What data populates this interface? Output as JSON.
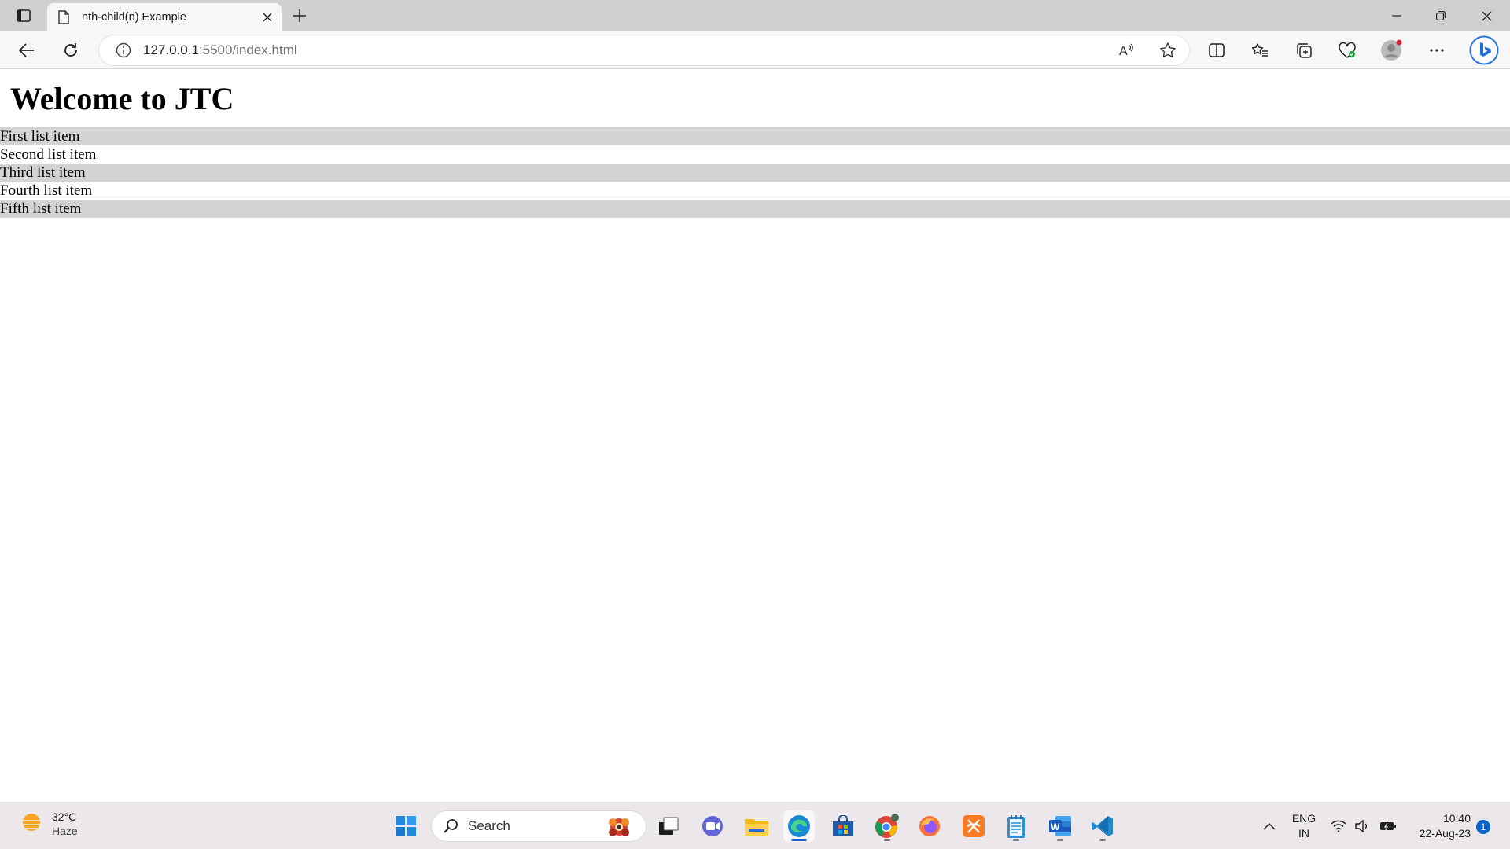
{
  "browser": {
    "tab_title": "nth-child(n) Example",
    "url_host": "127.0.0.1",
    "url_rest": ":5500/index.html"
  },
  "page": {
    "heading": "Welcome to JTC",
    "list_items": [
      "First list item",
      "Second list item",
      "Third list item",
      "Fourth list item",
      "Fifth list item"
    ],
    "stripe_color": "#d3d3d3"
  },
  "taskbar": {
    "weather_temp": "32°C",
    "weather_condition": "Haze",
    "search_label": "Search",
    "lang_primary": "ENG",
    "lang_secondary": "IN",
    "time": "10:40",
    "date": "22-Aug-23",
    "notification_count": "1"
  }
}
